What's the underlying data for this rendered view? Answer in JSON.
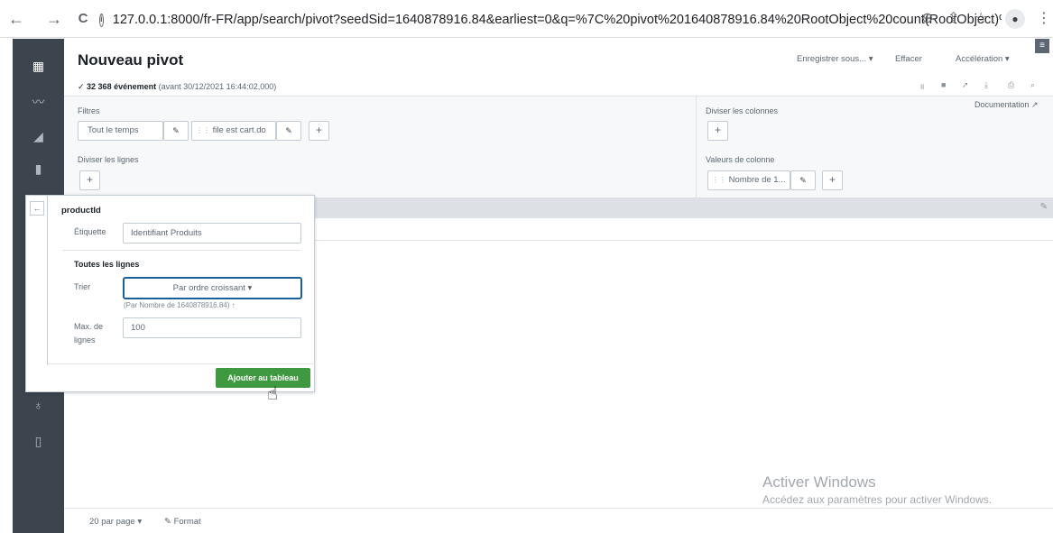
{
  "browser": {
    "back_icon": "←",
    "forward_icon": "→",
    "reload_icon": "C",
    "info_icon": "i",
    "url": "127.0.0.1:8000/fr-FR/app/search/pivot?seedSid=1640878916.84&earliest=0&q=%7C%20pivot%201640878916.84%20RootObject%20count(RootObject)%...",
    "zoom_icon": "⊕",
    "share_icon": "⇪",
    "star_icon": "☆",
    "profile_icon": "●",
    "more_icon": "⋮"
  },
  "page": {
    "title": "Nouveau pivot",
    "save_as": "Enregistrer sous... ▾",
    "clear": "Effacer",
    "acceleration": "Accélération ▾",
    "event_count": "✓ 32 368 événement",
    "event_time": "(avant 30/12/2021 16:44:02,000)",
    "documentation": "Documentation ↗",
    "menu_icon": "≡"
  },
  "config": {
    "filters_label": "Filtres",
    "filter_time": "Tout le temps",
    "filter_file": "file est cart.do",
    "split_rows_label": "Diviser les lignes",
    "split_columns_label": "Diviser les colonnes",
    "column_values_label": "Valeurs de colonne",
    "column_value_chip": "Nombre de 1...",
    "plus": "+",
    "edit_icon": "✎",
    "drag_handle": "⋮⋮"
  },
  "popover": {
    "back_icon": "←",
    "field_name": "productId",
    "label_label": "Étiquette",
    "label_value": "Identifiant Produits",
    "section": "Toutes les lignes",
    "sort_label": "Trier",
    "sort_value": "Par ordre croissant ▾",
    "sort_help": "(Par Nombre de 1640878916.84) ↑",
    "max_label_1": "Max. de",
    "max_label_2": "lignes",
    "max_value": "100",
    "add_button": "Ajouter au tableau"
  },
  "footer": {
    "per_page": "20 par page ▾",
    "format": "✎ Format"
  },
  "watermark": {
    "line1": "Activer Windows",
    "line2": "Accédez aux paramètres pour activer Windows."
  },
  "accent_colors": {
    "primary_button": "#3f9941",
    "focus_border": "#1a5f9b",
    "sidebar": "#3c444d"
  }
}
